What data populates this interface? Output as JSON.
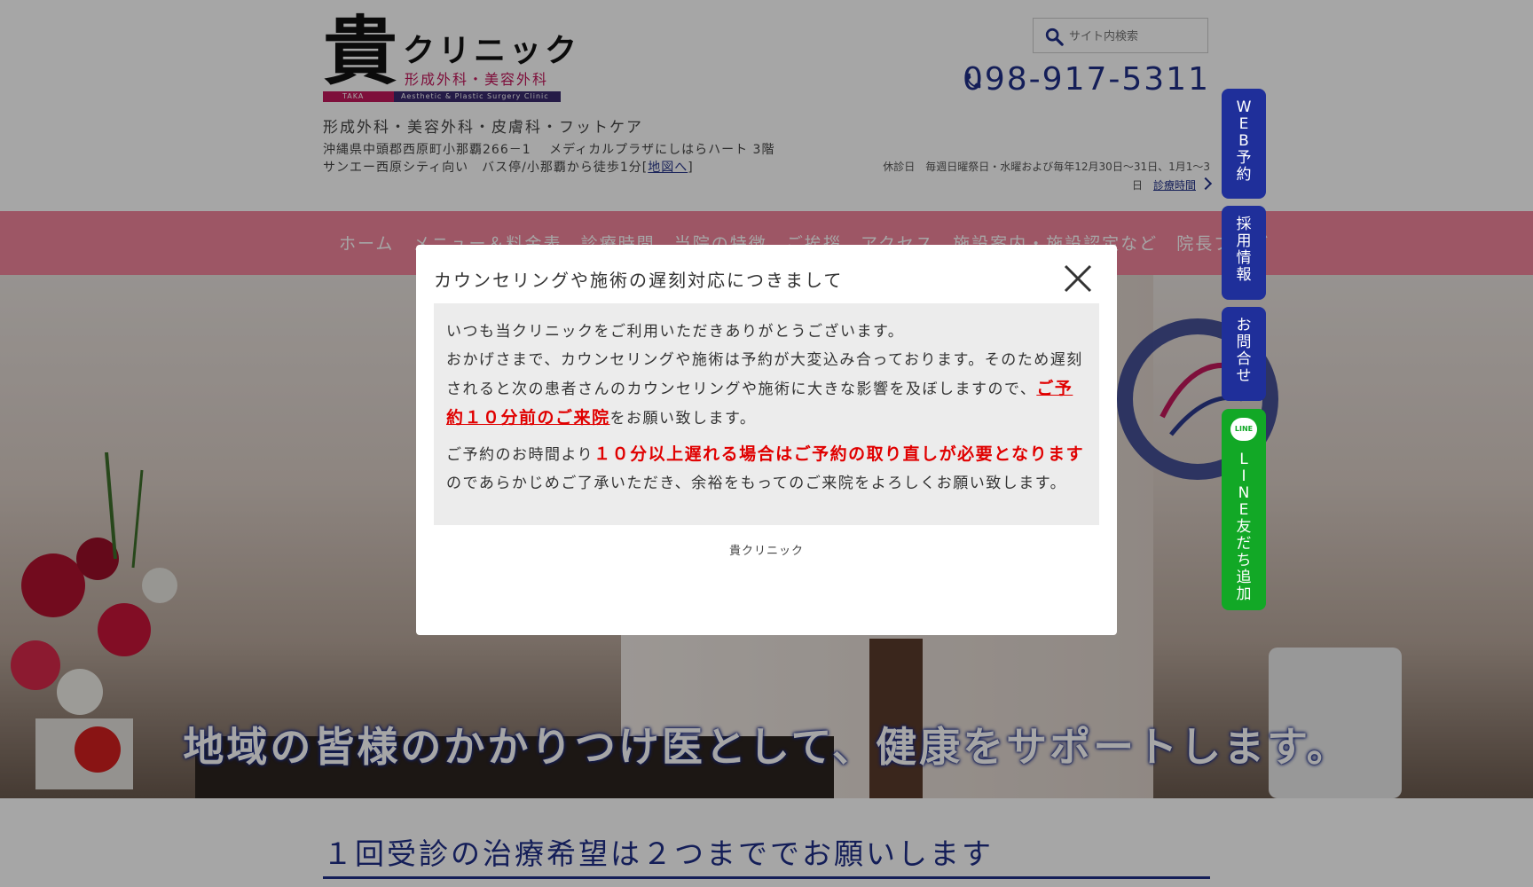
{
  "header": {
    "logo": {
      "kanji": "貴",
      "name": "クリニック",
      "subtitle": "形成外科・美容外科",
      "bar_left": "TAKA",
      "bar_right": "Aesthetic & Plastic Surgery Clinic"
    },
    "tagline": "形成外科・美容外科・皮膚科・フットケア",
    "address_line1": "沖縄県中頭郡西原町小那覇266－1　 メディカルプラザにしはらハート 3階",
    "address_line2_prefix": "サンエー西原シティ向い　バス停/小那覇から徒歩1分[",
    "address_map_link": "地図へ",
    "address_line2_suffix": "]",
    "search_placeholder": "サイト内検索",
    "phone": "098-917-5311",
    "hours_text": "休診日　毎週日曜祭日・水曜および毎年12月30日〜31日、1月1〜3日",
    "hours_link": "診療時間"
  },
  "nav": {
    "items": [
      "ホーム",
      "メニュー＆料金表",
      "診療時間",
      "当院の特徴",
      "ご挨拶",
      "アクセス",
      "施設案内・施設認定など",
      "院長ブログ"
    ]
  },
  "hero": {
    "caption": "地域の皆様のかかりつけ医として、健康をサポートします。"
  },
  "side_buttons": {
    "web": "WEB予約",
    "recruit": "採用情報",
    "contact": "お問合せ",
    "line_icon": "LINE",
    "line": "LINE友だち追加"
  },
  "modal": {
    "title": "カウンセリングや施術の遅刻対応につきまして",
    "p1": "いつも当クリニックをご利用いただきありがとうございます。",
    "p2a": "おかげさまで、カウンセリングや施術は予約が大変込み合っております。そのため遅刻されると次の患者さんのカウンセリングや施術に大きな影響を及ぼしますので、",
    "p2_highlight": "ご予約１０分前のご来院",
    "p2b": "をお願い致します。",
    "p3a": "ご予約のお時間より",
    "p3_highlight": "１０分以上遅れる場合はご予約の取り直しが必要となります",
    "p3b": "のであらかじめご了承いただき、余裕をもってのご来院をよろしくお願い致します。",
    "footer": "貴クリニック"
  },
  "section": {
    "title": "１回受診の治療希望は２つまででお願いします"
  },
  "colors": {
    "brand_blue": "#1f2f88",
    "nav_pink": "#f2849c",
    "line_green": "#12a826",
    "alert_red": "#e00000"
  }
}
